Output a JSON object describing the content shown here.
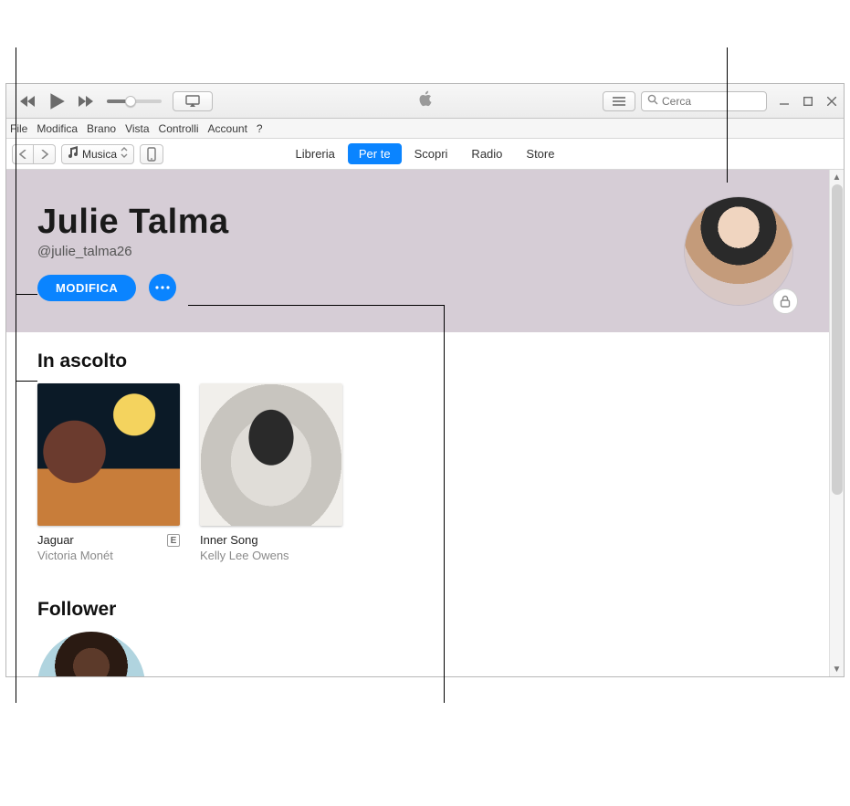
{
  "window": {
    "search_placeholder": "Cerca"
  },
  "menubar": {
    "items": [
      "File",
      "Modifica",
      "Brano",
      "Vista",
      "Controlli",
      "Account",
      "?"
    ]
  },
  "toolbar": {
    "media_selector": "Musica",
    "tabs": [
      {
        "label": "Libreria",
        "active": false
      },
      {
        "label": "Per te",
        "active": true
      },
      {
        "label": "Scopri",
        "active": false
      },
      {
        "label": "Radio",
        "active": false
      },
      {
        "label": "Store",
        "active": false
      }
    ]
  },
  "profile": {
    "name": "Julie Talma",
    "handle": "@julie_talma26",
    "edit_label": "MODIFICA"
  },
  "sections": {
    "listening_title": "In ascolto",
    "follower_title": "Follower",
    "albums": [
      {
        "title": "Jaguar",
        "artist": "Victoria Monét",
        "explicit": true
      },
      {
        "title": "Inner Song",
        "artist": "Kelly Lee Owens",
        "explicit": false
      }
    ],
    "explicit_badge": "E"
  }
}
